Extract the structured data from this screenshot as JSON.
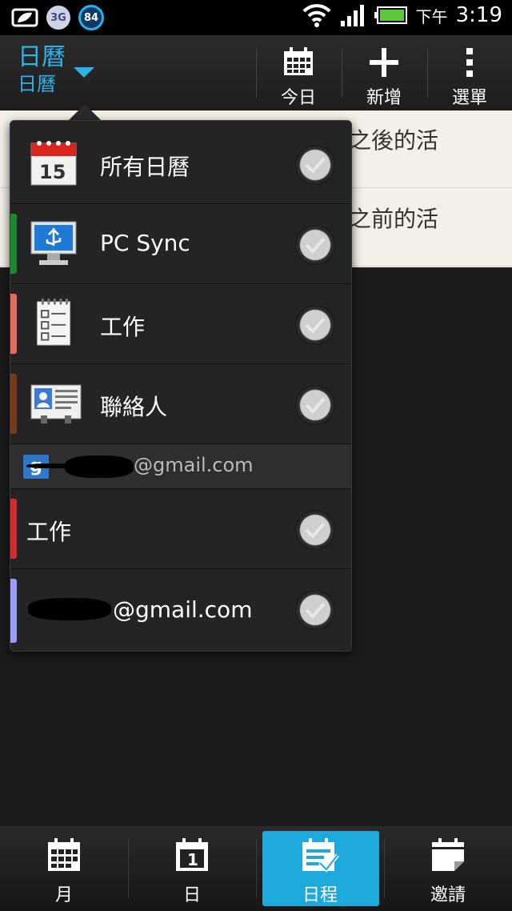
{
  "status_bar": {
    "network": "3G",
    "battery_badge": "84",
    "ampm": "下午",
    "time": "3:19"
  },
  "action_bar": {
    "title": "日曆",
    "subtitle": "日曆",
    "buttons": [
      {
        "label": "今日",
        "icon": "calendar-today-icon"
      },
      {
        "label": "新增",
        "icon": "plus-icon"
      },
      {
        "label": "選單",
        "icon": "overflow-menu-icon"
      }
    ]
  },
  "agenda": {
    "rows": [
      "之後的活",
      "之前的活"
    ]
  },
  "calendar_popup": {
    "items": [
      {
        "label": "所有日曆",
        "icon": "calendar-15-icon",
        "color": "",
        "checked": true
      },
      {
        "label": "PC Sync",
        "icon": "pc-usb-icon",
        "color": "#1a8a2a",
        "checked": true
      },
      {
        "label": "工作",
        "icon": "checklist-notepad-icon",
        "color": "#e86a5a",
        "checked": true
      },
      {
        "label": "聯絡人",
        "icon": "contact-card-icon",
        "color": "#7a3a1a",
        "checked": true
      }
    ],
    "google_account": {
      "icon": "google-g-icon",
      "email_suffix": "@gmail.com"
    },
    "google_items": [
      {
        "label": "工作",
        "color": "#d42a2a",
        "checked": true
      },
      {
        "label": "@gmail.com",
        "color": "#9a9aff",
        "checked": true
      }
    ]
  },
  "bottom_tabs": [
    {
      "label": "月",
      "icon": "month-grid-icon",
      "active": false
    },
    {
      "label": "日",
      "icon": "day-one-icon",
      "active": false
    },
    {
      "label": "日程",
      "icon": "agenda-check-icon",
      "active": true
    },
    {
      "label": "邀請",
      "icon": "invite-note-icon",
      "active": false
    }
  ],
  "colors": {
    "accent": "#2fb2e8",
    "active_tab": "#1da9dc"
  }
}
